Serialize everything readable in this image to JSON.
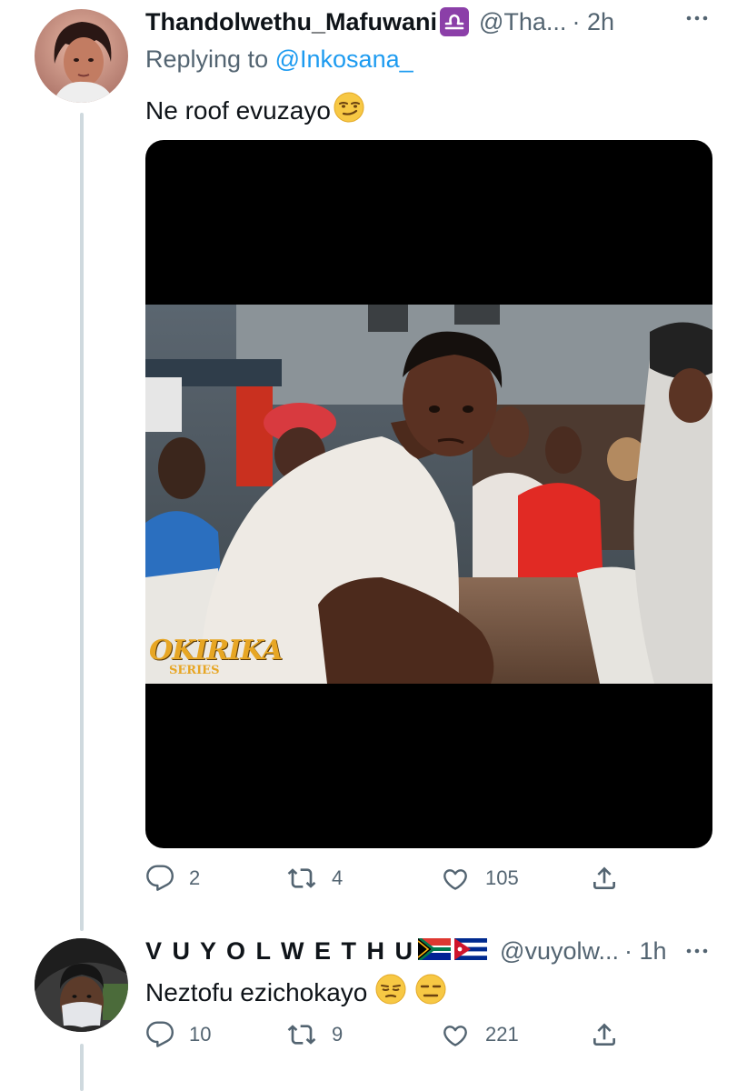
{
  "tweet1": {
    "display_name": "Thandolwethu_Mafuwani",
    "badge": "libra-zodiac-icon",
    "handle": "@Tha...",
    "time": "· 2h",
    "reply_prefix": "Replying to",
    "reply_handle": "@Inkosana_",
    "text": "Ne roof evuzayo",
    "text_emoji": "smirking-face-emoji",
    "media_watermark_main": "OKIRIKA",
    "media_watermark_sub": "SERIES",
    "replies": "2",
    "retweets": "4",
    "likes": "105"
  },
  "tweet2": {
    "display_name": "V U Y O L W E T H U",
    "flags": [
      "south-africa-flag",
      "cuba-flag"
    ],
    "handle": "@vuyolw...",
    "time": "· 1h",
    "text": "Neztofu ezichokayo",
    "text_emojis": [
      "unamused-face-emoji",
      "expressionless-face-emoji"
    ],
    "replies": "10",
    "retweets": "9",
    "likes": "221"
  },
  "colors": {
    "link": "#1d9bf0",
    "secondary_text": "#536471",
    "thread_line": "#cfd9de",
    "badge_purple": "#8b3fa8"
  }
}
